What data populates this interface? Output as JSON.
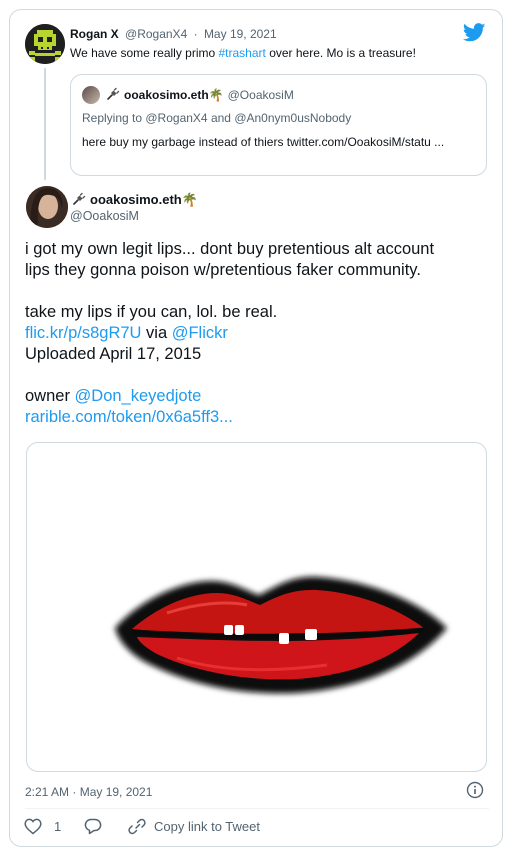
{
  "brand": {
    "twitter_icon": "twitter-bird-icon",
    "accent": "#1d9bf0"
  },
  "parent": {
    "name": "Rogan X",
    "handle": "@RoganX4",
    "dot": "·",
    "date": "May 19, 2021",
    "text_before": "We have some really primo ",
    "hashtag": "#trashart",
    "text_after": " over here. Mo is a treasure!"
  },
  "quote": {
    "name": "ooakosimo.eth🌴",
    "handle": "@OoakosiM",
    "reply_prefix": "Replying to ",
    "reply_mention1": "@RoganX4",
    "reply_and": " and ",
    "reply_mention2": "@An0nym0usNobody",
    "body": "here buy my garbage instead of thiers twitter.com/OoakosiM/statu ..."
  },
  "tweet": {
    "name": "ooakosimo.eth🌴",
    "handle": "@OoakosiM",
    "line1": "i got my own legit lips... dont buy pretentious alt account",
    "line2": "lips they gonna poison w/pretentious faker community.",
    "line3": "take my lips if you can, lol. be real.",
    "flickr_link": "flic.kr/p/s8gR7U",
    "via": " via ",
    "flickr_mention": "@Flickr",
    "uploaded": "Uploaded April 17, 2015",
    "owner_label": "owner ",
    "owner_mention": "@Don_keyedjote",
    "rarible_link": "rarible.com/token/0x6a5ff3...",
    "timestamp": "2:21 AM · May 19, 2021"
  },
  "actions": {
    "like_count": "1",
    "copy_link": "Copy link to Tweet"
  }
}
